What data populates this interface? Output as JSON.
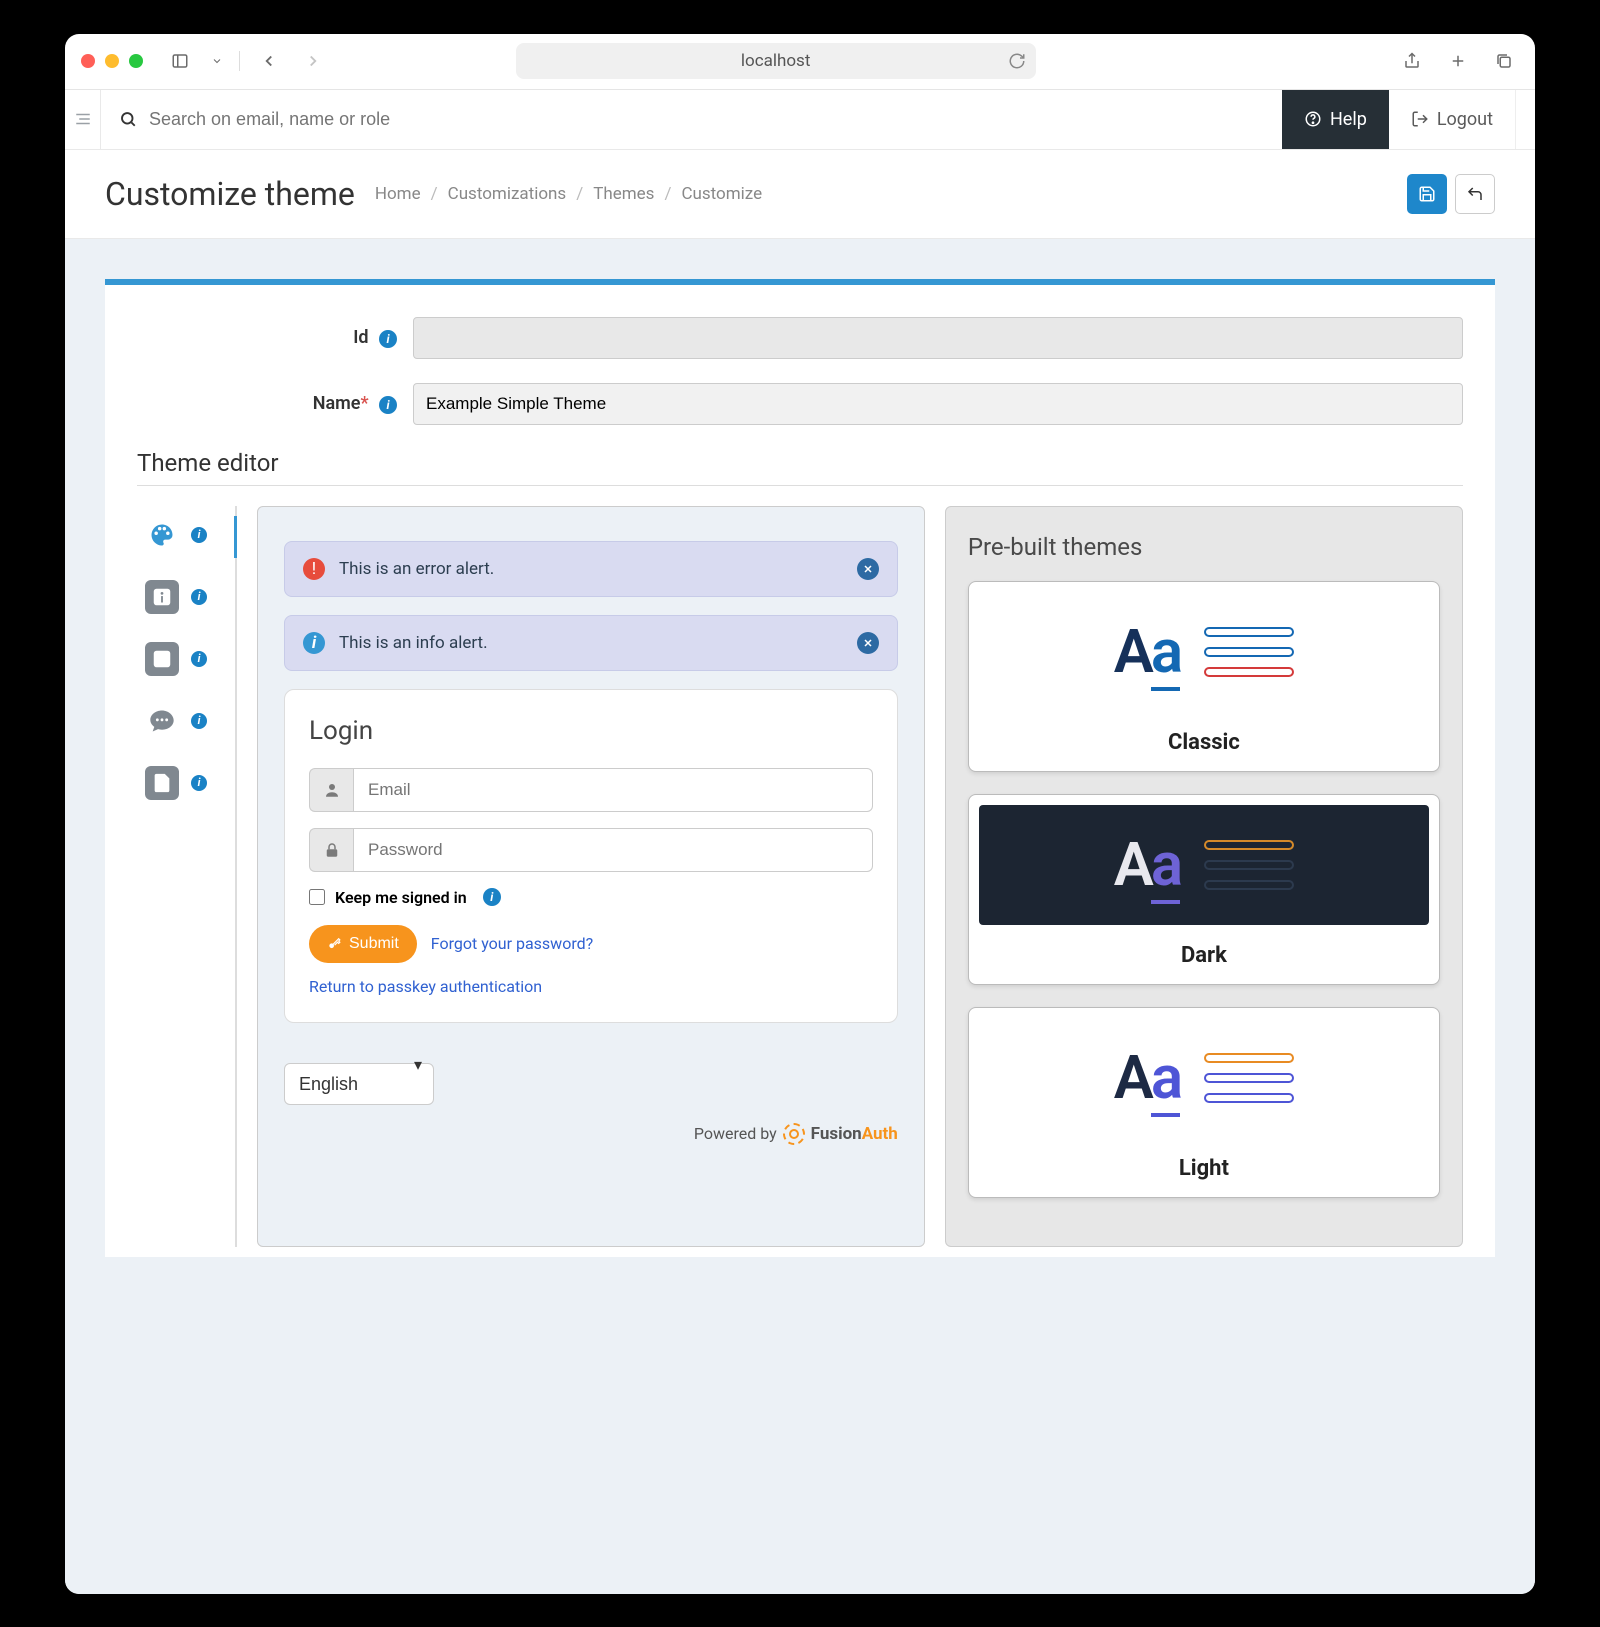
{
  "browser": {
    "url": "localhost"
  },
  "topbar": {
    "search_placeholder": "Search on email, name or role",
    "help": "Help",
    "logout": "Logout"
  },
  "header": {
    "title": "Customize theme",
    "crumbs": [
      "Home",
      "Customizations",
      "Themes",
      "Customize"
    ]
  },
  "form": {
    "id_label": "Id",
    "id_value": "",
    "name_label": "Name",
    "name_value": "Example Simple Theme"
  },
  "section_title": "Theme editor",
  "alerts": {
    "error": "This is an error alert.",
    "info": "This is an info alert."
  },
  "login": {
    "heading": "Login",
    "email_placeholder": "Email",
    "password_placeholder": "Password",
    "keep_signed": "Keep me signed in",
    "submit": "Submit",
    "forgot": "Forgot your password?",
    "passkey": "Return to passkey authentication"
  },
  "lang": "English",
  "powered": "Powered by",
  "brand": {
    "text1": "Fusion",
    "text2": "Auth"
  },
  "themes": {
    "heading": "Pre-built themes",
    "items": [
      {
        "name": "Classic",
        "cls": "classic"
      },
      {
        "name": "Dark",
        "cls": "dark"
      },
      {
        "name": "Light",
        "cls": "light"
      }
    ]
  }
}
